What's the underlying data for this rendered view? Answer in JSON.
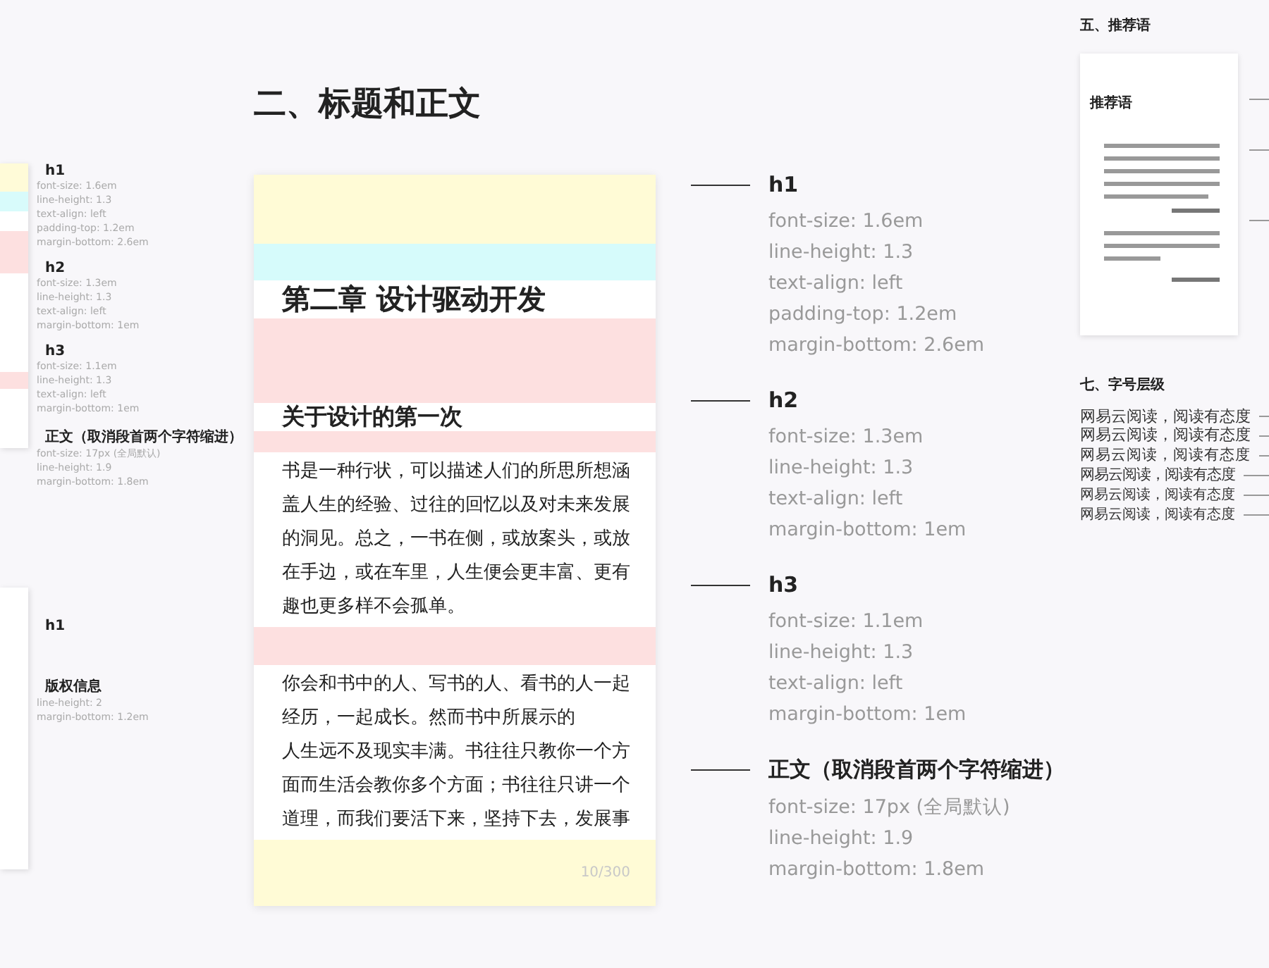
{
  "section_title": "二、标题和正文",
  "left_specs": [
    {
      "name": "h1",
      "props": [
        "font-size: 1.6em",
        "line-height: 1.3",
        "text-align: left",
        "padding-top: 1.2em",
        "margin-bottom: 2.6em"
      ]
    },
    {
      "name": "h2",
      "props": [
        "font-size: 1.3em",
        "line-height: 1.3",
        "text-align: left",
        "margin-bottom: 1em"
      ]
    },
    {
      "name": "h3",
      "props": [
        "font-size: 1.1em",
        "line-height: 1.3",
        "text-align: left",
        "margin-bottom: 1em"
      ]
    },
    {
      "name": "正文（取消段首两个字符缩进）",
      "props": [
        "font-size: 17px (全局默认)",
        "line-height: 1.9",
        "margin-bottom: 1.8em"
      ]
    }
  ],
  "left_specs_lower": [
    {
      "name": "h1"
    },
    {
      "name": "版权信息",
      "props": [
        "line-height: 2",
        "margin-bottom: 1.2em"
      ]
    }
  ],
  "preview": {
    "h1": "第二章 设计驱动开发",
    "h2": "关于设计的第一次",
    "paragraphs": [
      [
        "书是一种行状，可以描述人们的所思所想涵",
        "盖人生的经验、过往的回忆以及对未来发展",
        "的洞见。总之，一书在侧，或放案头，或放",
        "在手边，或在车里，人生便会更丰富、更有",
        "趣也更多样不会孤单。"
      ],
      [
        "你会和书中的人、写书的人、看书的人一起",
        "经历，一起成长。然而书中所展示的",
        "人生远不及现实丰满。书往往只教你一个方",
        "面而生活会教你多个方面；书往往只讲一个",
        "道理，而我们要活下来，坚持下去，发展事"
      ]
    ],
    "page_number": "10/300"
  },
  "specs": [
    {
      "name": "h1",
      "props": [
        "font-size: 1.6em",
        "line-height: 1.3",
        "text-align: left",
        "padding-top: 1.2em",
        "margin-bottom: 2.6em"
      ]
    },
    {
      "name": "h2",
      "props": [
        "font-size: 1.3em",
        "line-height: 1.3",
        "text-align: left",
        "margin-bottom: 1em"
      ]
    },
    {
      "name": "h3",
      "props": [
        "font-size: 1.1em",
        "line-height: 1.3",
        "text-align: left",
        "margin-bottom: 1em"
      ]
    },
    {
      "name": "正文（取消段首两个字符缩进）",
      "props": [
        "font-size: 17px (全局默认)",
        "line-height: 1.9",
        "margin-bottom: 1.8em"
      ]
    }
  ],
  "recommend": {
    "section_title": "五、推荐语",
    "card_title": "推荐语"
  },
  "font_levels": {
    "section_title": "七、字号层级",
    "samples": [
      "网易云阅读，阅读有态度",
      "网易云阅读，阅读有态度",
      "网易云阅读，阅读有态度",
      "网易云阅读，阅读有态度",
      "网易云阅读，阅读有态度",
      "网易云阅读，阅读有态度"
    ]
  }
}
